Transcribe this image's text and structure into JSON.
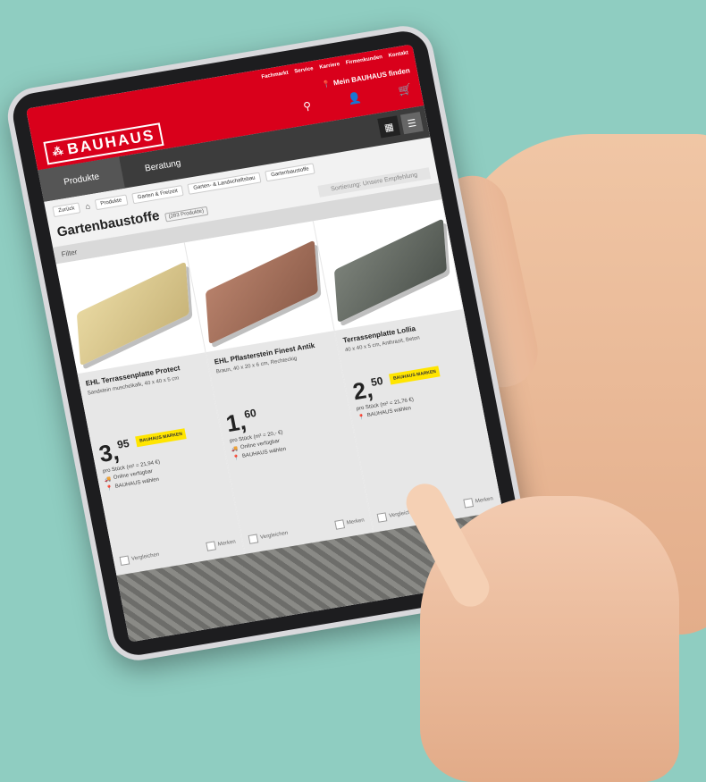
{
  "header": {
    "utility_links": [
      "Fachmarkt",
      "Service",
      "Karriere",
      "Firmenkunden",
      "Kontakt"
    ],
    "store_label": "Mein BAUHAUS finden",
    "logo": "BAUHAUS"
  },
  "nav": {
    "items": [
      "Produkte",
      "Beratung"
    ]
  },
  "breadcrumb": [
    "Zurück",
    "Produkte",
    "Garten & Freizeit",
    "Garten- & Landschaftsbau",
    "Gartenbaustoffe"
  ],
  "page": {
    "title": "Gartenbaustoffe",
    "count": "(283 Produkte)",
    "sort_label": "Sortierung: Unsere Empfehlung",
    "filter_label": "Filter"
  },
  "products": [
    {
      "name": "EHL Terrassenplatte Protect",
      "desc": "Sandstein muschelkalk, 40 x 40 x 5 cm",
      "price_main": "3,",
      "price_cents": "95",
      "badge": "BAUHAUS MARKEN",
      "unit_price": "pro Stück (m² = 21,94 €)",
      "avail_online": "Online verfügbar",
      "avail_store": "BAUHAUS wählen",
      "compare": "Vergleichen",
      "note": "Merken"
    },
    {
      "name": "EHL Pflasterstein Finest Antik",
      "desc": "Braun, 40 x 20 x 6 cm, Rechteckig",
      "price_main": "1,",
      "price_cents": "60",
      "badge": "",
      "unit_price": "pro Stück (m² = 20,- €)",
      "avail_online": "Online verfügbar",
      "avail_store": "BAUHAUS wählen",
      "compare": "Vergleichen",
      "note": "Merken"
    },
    {
      "name": "Terrassenplatte Lollia",
      "desc": "40 x 40 x 5 cm, Anthrazit, Beton",
      "price_main": "2,",
      "price_cents": "50",
      "badge": "BAUHAUS MARKEN",
      "unit_price": "pro Stück (m² = 21,76 €)",
      "avail_online": "",
      "avail_store": "BAUHAUS wählen",
      "compare": "Vergleichen",
      "note": "Merken"
    }
  ]
}
